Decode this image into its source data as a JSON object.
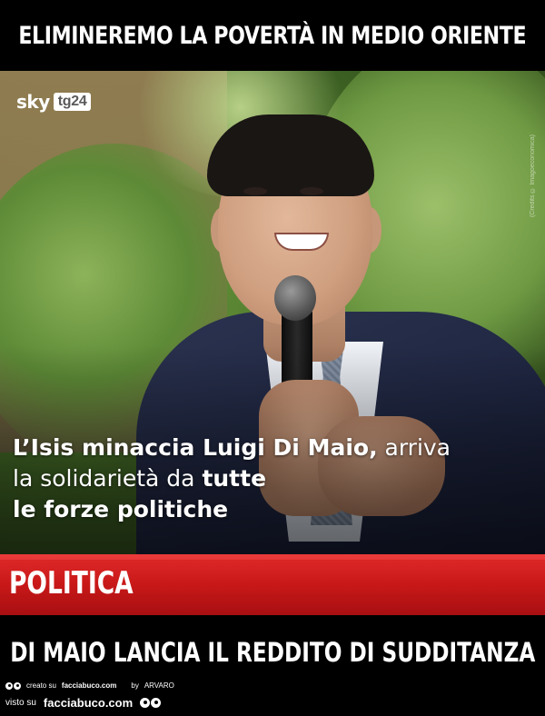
{
  "top_caption": "ELIMINEREMO LA POVERTÀ IN MEDIO ORIENTE",
  "logo": {
    "brand": "sky",
    "channel": "tg24"
  },
  "photo_credit": "(Credits © Imagoeconomica)",
  "headline": {
    "part1_bold": "L’Isis minaccia Luigi Di Maio,",
    "part2_light": " arriva",
    "part3_light": "la solidarietà da ",
    "part4_bold": "tutte",
    "part5_bold": "le forze politiche"
  },
  "section_label": "POLITICA",
  "bottom_caption": "DI MAIO LANCIA IL REDDITO DI SUDDITANZA",
  "footer": {
    "created_text": "creato su",
    "created_site": "facciabuco.com",
    "by_text": "by",
    "author": "ARVARO",
    "seen_text": "visto su",
    "seen_site": "facciabuco.com"
  },
  "colors": {
    "section_red": "#c81818",
    "background": "#000000"
  }
}
